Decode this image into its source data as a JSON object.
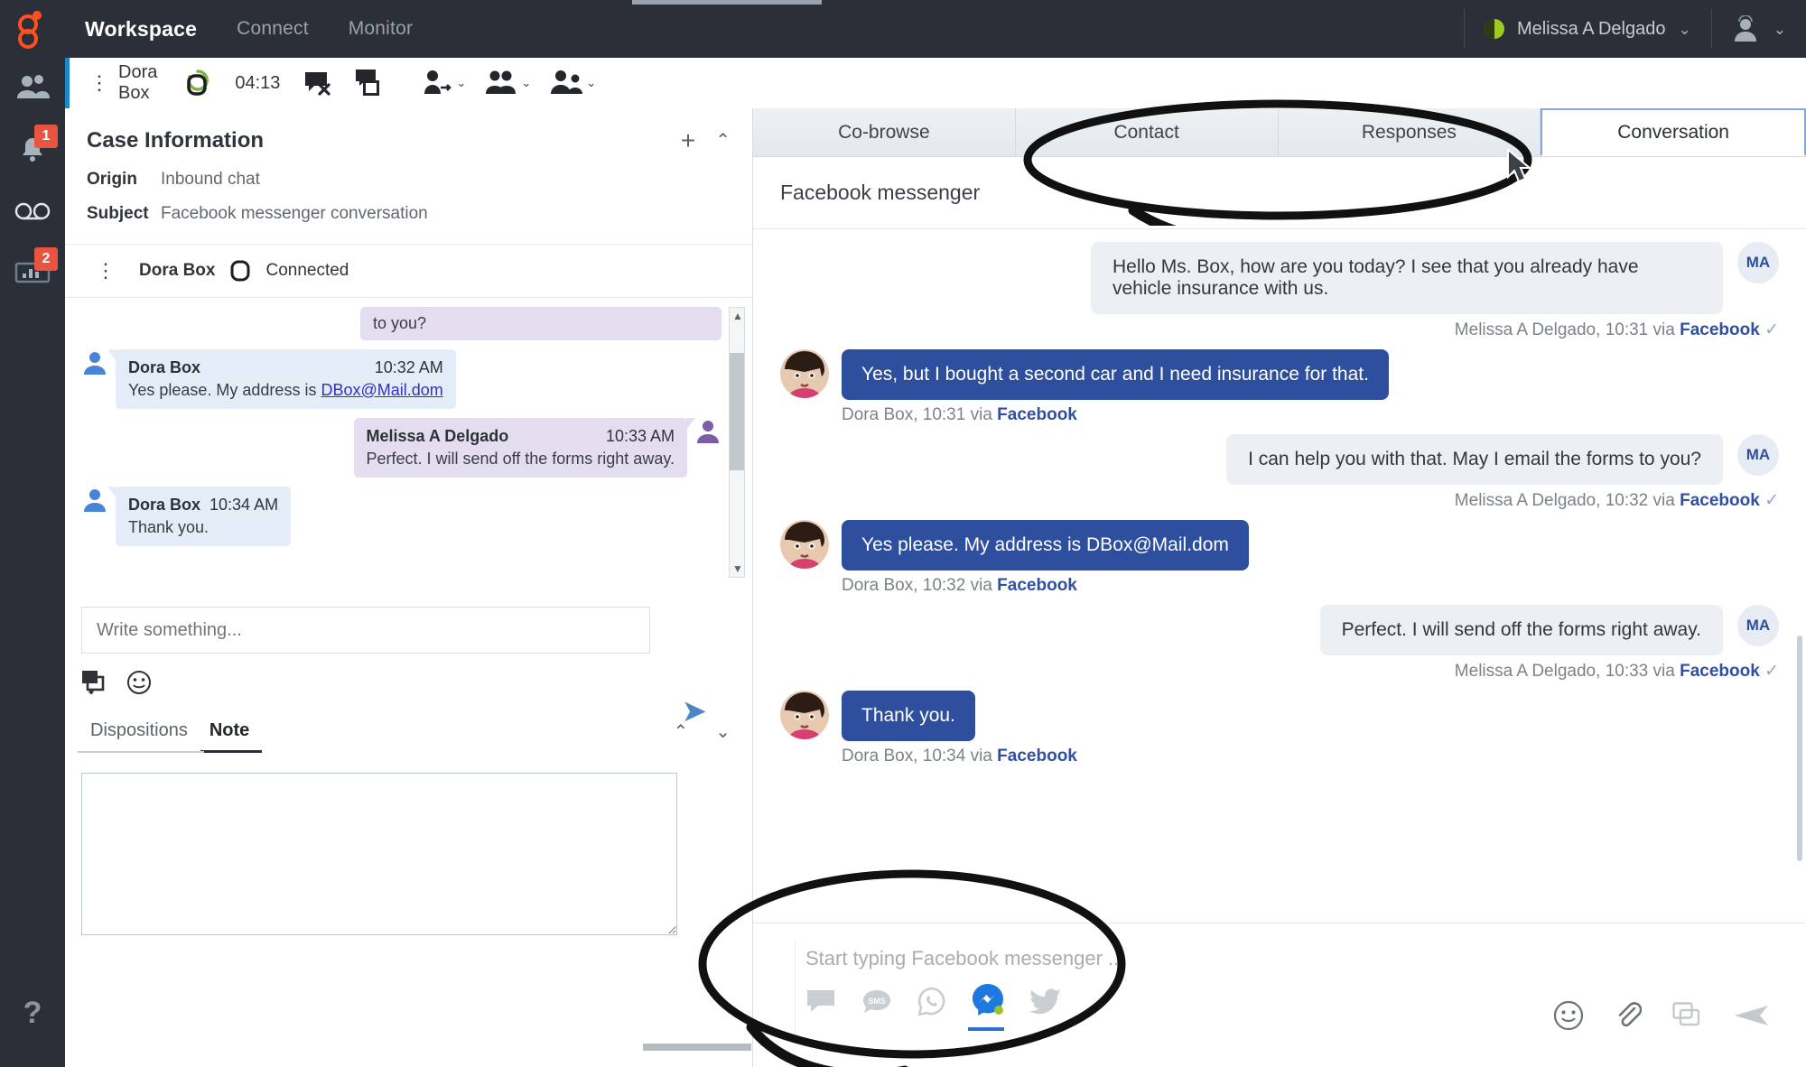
{
  "topbar": {
    "nav": [
      {
        "label": "Workspace",
        "active": true
      },
      {
        "label": "Connect",
        "active": false
      },
      {
        "label": "Monitor",
        "active": false
      }
    ],
    "agent_name": "Melissa A Delgado",
    "agent_status_color": "#9ecb1e",
    "caret": "⌄"
  },
  "rail": {
    "items": [
      {
        "icon": "contacts-group-icon",
        "badge": ""
      },
      {
        "icon": "bell-icon",
        "badge": "1"
      },
      {
        "icon": "voicemail-icon",
        "badge": ""
      },
      {
        "icon": "statistics-icon",
        "badge": "2"
      }
    ],
    "help": "?"
  },
  "interaction_bar": {
    "kebab": "⋮",
    "party": "Dora Box",
    "timer": "04:13",
    "icons": [
      "chat-status-icon",
      "end-chat-icon",
      "transfer-chat-icon",
      "transfer-party-icon",
      "conference-icon",
      "consult-icon"
    ]
  },
  "case_information": {
    "title": "Case Information",
    "add_label": "+",
    "collapse_label": "⌃",
    "rows": [
      {
        "label": "Origin",
        "value": "Inbound chat"
      },
      {
        "label": "Subject",
        "value": "Facebook messenger conversation"
      }
    ]
  },
  "channel_header": {
    "kebab": "⋮",
    "name": "Dora Box",
    "status": "Connected"
  },
  "transcript": {
    "partial": "to you?",
    "messages": [
      {
        "direction": "in",
        "name": "Dora Box",
        "time": "10:32 AM",
        "text": "Yes please. My address is ",
        "link": "DBox@Mail.dom",
        "inline_time": false
      },
      {
        "direction": "out",
        "name": "Melissa A Delgado",
        "time": "10:33 AM",
        "text": "Perfect. I will send off the forms right away.",
        "link": "",
        "inline_time": false
      },
      {
        "direction": "in",
        "name": "Dora Box",
        "time": "10:34 AM",
        "text": "Thank you.",
        "link": "",
        "inline_time": true
      }
    ]
  },
  "left_composer": {
    "placeholder": "Write something...",
    "send_label": "➤",
    "icons": [
      "canned-response-icon",
      "emoji-icon"
    ]
  },
  "left_tabs": {
    "items": [
      {
        "label": "Dispositions",
        "active": false
      },
      {
        "label": "Note",
        "active": true
      }
    ],
    "collapse_up": "⌃",
    "collapse_down": "⌄",
    "note_value": ""
  },
  "right_tabs": {
    "items": [
      {
        "label": "Co-browse",
        "active": false
      },
      {
        "label": "Contact",
        "active": false
      },
      {
        "label": "Responses",
        "active": false
      },
      {
        "label": "Conversation",
        "active": true
      }
    ]
  },
  "conversation": {
    "channel_title": "Facebook messenger",
    "messages": [
      {
        "side": "right",
        "text": "Hello Ms. Box, how are you today? I see that you already have vehicle insurance with us.",
        "author": "Melissa A Delgado",
        "time": "10:31",
        "via": "Facebook",
        "initials": "MA",
        "delivered": "✓"
      },
      {
        "side": "left",
        "text": "Yes, but I bought a second car and I need insurance for that.",
        "author": "Dora Box",
        "time": "10:31",
        "via": "Facebook",
        "initials": "",
        "delivered": ""
      },
      {
        "side": "right",
        "text": "I can help you with that. May I email the forms to you?",
        "author": "Melissa A Delgado",
        "time": "10:32",
        "via": "Facebook",
        "initials": "MA",
        "delivered": "✓"
      },
      {
        "side": "left",
        "text": "Yes please. My address is DBox@Mail.dom",
        "author": "Dora Box",
        "time": "10:32",
        "via": "Facebook",
        "initials": "",
        "delivered": ""
      },
      {
        "side": "right",
        "text": "Perfect. I will send off the forms right away.",
        "author": "Melissa A Delgado",
        "time": "10:33",
        "via": "Facebook",
        "initials": "MA",
        "delivered": "✓"
      },
      {
        "side": "left",
        "text": "Thank you.",
        "author": "Dora Box",
        "time": "10:34",
        "via": "Facebook",
        "initials": "",
        "delivered": ""
      }
    ],
    "via_word": "via",
    "comma": ", "
  },
  "right_composer": {
    "placeholder": "Start typing Facebook messenger ...",
    "channels": [
      {
        "name": "chat-icon",
        "active": false
      },
      {
        "name": "sms-icon",
        "active": false
      },
      {
        "name": "whatsapp-icon",
        "active": false
      },
      {
        "name": "facebook-messenger-icon",
        "active": true
      },
      {
        "name": "twitter-icon",
        "active": false
      }
    ],
    "tools": [
      "emoji-icon",
      "attachment-icon",
      "canned-response-icon",
      "send-icon"
    ]
  },
  "colors": {
    "brand_dark": "#2b2f37",
    "accent_blue": "#2e4f9e",
    "badge_red": "#e8543f",
    "link_blue": "#2f4fa0"
  }
}
